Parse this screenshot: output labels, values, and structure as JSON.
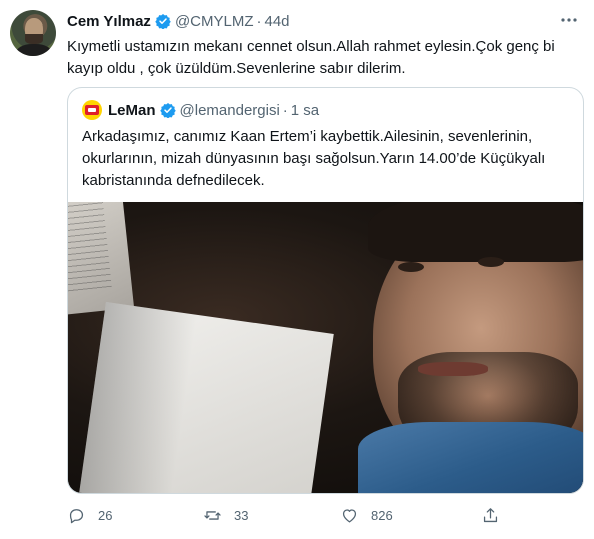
{
  "tweet": {
    "author_name": "Cem Yılmaz",
    "handle": "@CMYLMZ",
    "separator": "·",
    "time": "44d",
    "text": "Kıymetli ustamızın mekanı cennet olsun.Allah rahmet eylesin.Çok genç bi kayıp oldu , çok üzüldüm.Sevenlerine sabır dilerim."
  },
  "quote": {
    "author_name": "LeMan",
    "handle": "@lemandergisi",
    "separator": "·",
    "time": "1 sa",
    "text": "Arkadaşımız, canımız Kaan Ertem’i kaybettik.Ailesinin, sevenlerinin, okurlarının, mizah dünyasının başı sağolsun.Yarın 14.00’de Küçükyalı kabristanında defnedilecek."
  },
  "actions": {
    "reply_count": "26",
    "retweet_count": "33",
    "like_count": "826"
  },
  "colors": {
    "verified_blue": "#1d9bf0",
    "secondary_text": "#536471",
    "border": "#cfd9de"
  },
  "icons": [
    "verified-badge-icon",
    "more-icon",
    "reply-icon",
    "retweet-icon",
    "like-icon",
    "share-icon"
  ]
}
